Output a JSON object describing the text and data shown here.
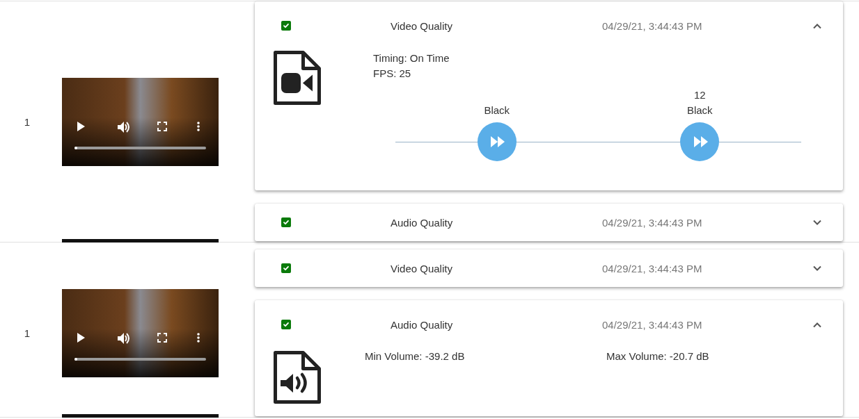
{
  "rows": [
    {
      "index": "1",
      "video": {
        "level": 0.02
      },
      "panels": [
        {
          "kind": "video",
          "checked": true,
          "title": "Video Quality",
          "time": "04/29/21, 3:44:43 PM",
          "expanded": true,
          "details": [
            "Timing: On Time",
            "FPS: 25"
          ],
          "markers": [
            {
              "lines": [
                "Black"
              ]
            },
            {
              "lines": [
                "12",
                "Black"
              ]
            }
          ]
        },
        {
          "checked": true,
          "title": "Audio Quality",
          "time": "04/29/21, 3:44:43 PM",
          "expanded": false
        }
      ]
    },
    {
      "index": "1",
      "video": {
        "level": 0.02
      },
      "panels": [
        {
          "checked": true,
          "title": "Video Quality",
          "time": "04/29/21, 3:44:43 PM",
          "expanded": false
        },
        {
          "kind": "audio",
          "checked": true,
          "title": "Audio Quality",
          "time": "04/29/21, 3:44:43 PM",
          "expanded": true,
          "details": [
            "Min Volume: -39.2 dB",
            "Max Volume: -20.7 dB"
          ]
        }
      ]
    }
  ]
}
